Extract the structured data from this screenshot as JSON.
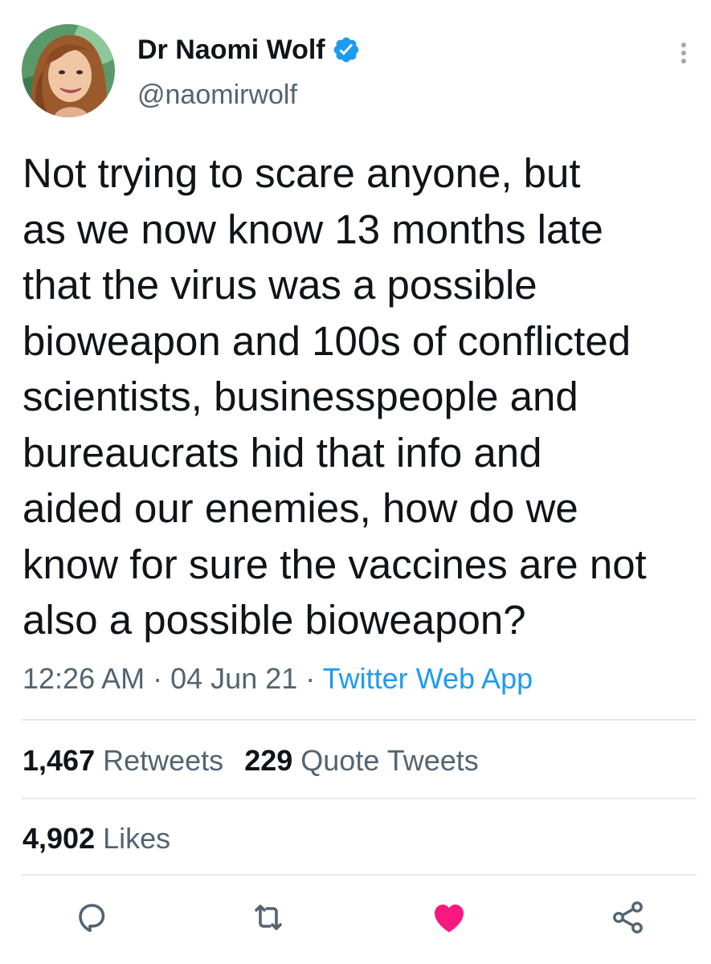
{
  "author": {
    "display_name": "Dr Naomi Wolf",
    "handle": "@naomirwolf",
    "verified": true
  },
  "tweet": {
    "text": "Not trying to scare anyone, but\nas we now know 13 months late\nthat the virus was a possible\nbioweapon and 100s of conflicted\nscientists, businesspeople and\nbureaucrats hid that info and\naided our enemies, how do we\nknow for sure the vaccines are not\nalso a possible bioweapon?",
    "time": "12:26 AM",
    "separator": "·",
    "date": "04 Jun 21",
    "source": "Twitter Web App"
  },
  "stats": {
    "retweets_count": "1,467",
    "retweets_label": "Retweets",
    "quotes_count": "229",
    "quotes_label": "Quote Tweets",
    "likes_count": "4,902",
    "likes_label": "Likes"
  },
  "icons": {
    "verified": "verified-badge-icon",
    "more": "more-options-icon",
    "reply": "reply-icon",
    "retweet": "retweet-icon",
    "like": "heart-icon",
    "share": "share-icon"
  },
  "colors": {
    "text": "#0f1419",
    "secondary": "#536471",
    "link": "#1d9bf0",
    "verified": "#1d9bf0",
    "liked": "#f91880",
    "divider": "#e6e9eb"
  }
}
